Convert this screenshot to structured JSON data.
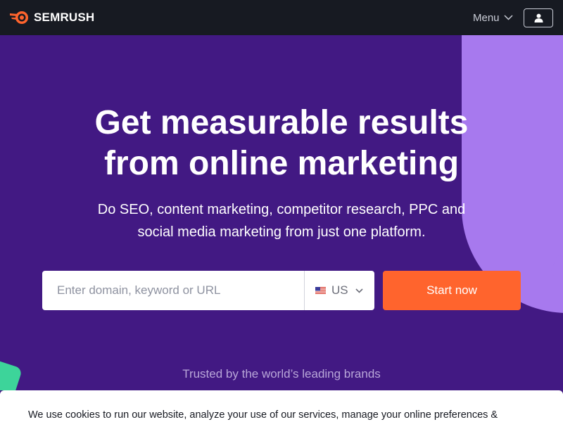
{
  "header": {
    "logo_text": "SEMRUSH",
    "logo_icon": "semrush-fireball-logo",
    "menu_label": "Menu",
    "user_icon": "user-icon"
  },
  "hero": {
    "headline_line1": "Get measurable results",
    "headline_line2": "from online marketing",
    "subhead_line1": "Do SEO, content marketing, competitor research, PPC and",
    "subhead_line2": "social media marketing from just one platform.",
    "search": {
      "placeholder": "Enter domain, keyword or URL",
      "value": ""
    },
    "country_selector": {
      "selected": "US",
      "flag": "us-flag"
    },
    "cta_label": "Start now",
    "trusted_text": "Trusted by the world’s leading brands"
  },
  "cookie_banner": {
    "text": "We use cookies to run our website, analyze your use of our services, manage your online preferences &"
  },
  "colors": {
    "topbar": "#171a22",
    "hero_bg": "#421983",
    "accent_shape": "#a779ee",
    "cta": "#ff642d",
    "green_shape": "#3dd49a"
  }
}
